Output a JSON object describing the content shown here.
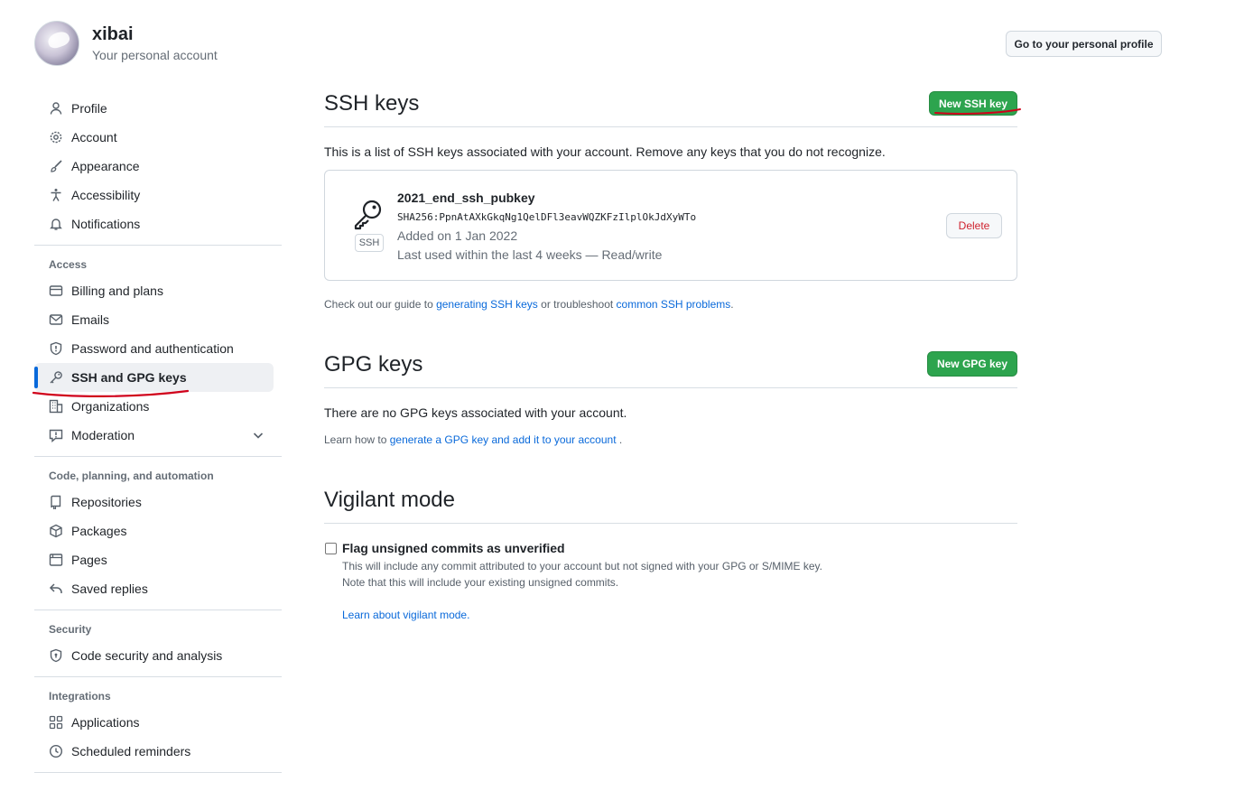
{
  "header": {
    "user_name": "xibai",
    "user_sub": "Your personal account",
    "profile_button": "Go to your personal profile"
  },
  "sidebar": {
    "group1": [
      {
        "label": "Profile",
        "icon": "person-icon"
      },
      {
        "label": "Account",
        "icon": "gear-icon"
      },
      {
        "label": "Appearance",
        "icon": "paintbrush-icon"
      },
      {
        "label": "Accessibility",
        "icon": "accessibility-icon"
      },
      {
        "label": "Notifications",
        "icon": "bell-icon"
      }
    ],
    "access_heading": "Access",
    "access": [
      {
        "label": "Billing and plans",
        "icon": "credit-card-icon"
      },
      {
        "label": "Emails",
        "icon": "mail-icon"
      },
      {
        "label": "Password and authentication",
        "icon": "shield-icon"
      },
      {
        "label": "SSH and GPG keys",
        "icon": "key-icon"
      },
      {
        "label": "Organizations",
        "icon": "organization-icon"
      },
      {
        "label": "Moderation",
        "icon": "report-icon"
      }
    ],
    "code_heading": "Code, planning, and automation",
    "code": [
      {
        "label": "Repositories",
        "icon": "repo-icon"
      },
      {
        "label": "Packages",
        "icon": "package-icon"
      },
      {
        "label": "Pages",
        "icon": "browser-icon"
      },
      {
        "label": "Saved replies",
        "icon": "reply-icon"
      }
    ],
    "security_heading": "Security",
    "security": [
      {
        "label": "Code security and analysis",
        "icon": "shield-lock-icon"
      }
    ],
    "integrations_heading": "Integrations",
    "integrations": [
      {
        "label": "Applications",
        "icon": "apps-icon"
      },
      {
        "label": "Scheduled reminders",
        "icon": "clock-icon"
      }
    ]
  },
  "ssh": {
    "title": "SSH keys",
    "new_button": "New SSH key",
    "description": "This is a list of SSH keys associated with your account. Remove any keys that you do not recognize.",
    "key": {
      "name": "2021_end_ssh_pubkey",
      "fingerprint": "SHA256:PpnAtAXkGkqNg1QelDFl3eavWQZKFzIlplOkJdXyWTo",
      "added": "Added on 1 Jan 2022",
      "last_used": "Last used within the last 4 weeks — Read/write",
      "badge": "SSH",
      "delete_button": "Delete"
    },
    "guide_prefix": "Check out our guide to ",
    "guide_link1": "generating SSH keys",
    "guide_middle": " or troubleshoot ",
    "guide_link2": "common SSH problems",
    "guide_suffix": "."
  },
  "gpg": {
    "title": "GPG keys",
    "new_button": "New GPG key",
    "description": "There are no GPG keys associated with your account.",
    "learn_prefix": "Learn how to ",
    "learn_link": "generate a GPG key and add it to your account",
    "learn_suffix": " ."
  },
  "vigilant": {
    "title": "Vigilant mode",
    "checkbox_label": "Flag unsigned commits as unverified",
    "help1": "This will include any commit attributed to your account but not signed with your GPG or S/MIME key.",
    "help2": "Note that this will include your existing unsigned commits.",
    "learn_link": "Learn about vigilant mode."
  },
  "colors": {
    "accent_blue": "#0969da",
    "green_button": "#2da44e",
    "annotation_red": "#d0021b",
    "danger": "#cf222e"
  }
}
